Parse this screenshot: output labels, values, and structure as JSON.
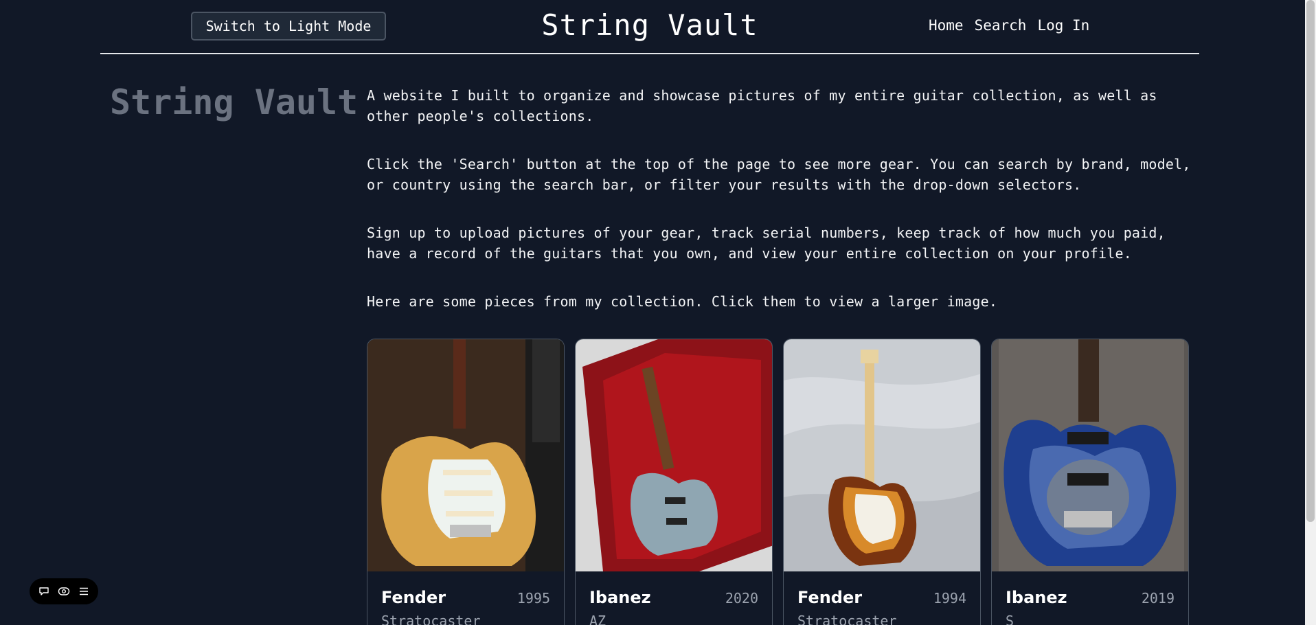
{
  "header": {
    "theme_button": "Switch to Light Mode",
    "title": "String Vault",
    "nav": [
      "Home",
      "Search",
      "Log In"
    ]
  },
  "side_title": "String Vault",
  "intro": [
    "A website I built to organize and showcase pictures of my entire guitar collection, as well as other people's collections.",
    "Click the 'Search' button at the top of the page to see more gear. You can search by brand, model, or country using the search bar, or filter your results with the drop-down selectors.",
    "Sign up to upload pictures of your gear, track serial numbers, keep track of how much you paid, have a record of the guitars that you own, and view your entire collection on your profile.",
    "Here are some pieces from my collection. Click them to view a larger image."
  ],
  "cards": [
    {
      "brand": "Fender",
      "year": "1995",
      "model": "Stratocaster"
    },
    {
      "brand": "Ibanez",
      "year": "2020",
      "model": "AZ"
    },
    {
      "brand": "Fender",
      "year": "1994",
      "model": "Stratocaster"
    },
    {
      "brand": "Ibanez",
      "year": "2019",
      "model": "S"
    }
  ],
  "colors": {
    "background": "#111827",
    "side_title": "#6b7280",
    "muted": "#9ca3af"
  },
  "toolbar_icons": [
    "chat-icon",
    "eye-icon",
    "menu-icon"
  ]
}
